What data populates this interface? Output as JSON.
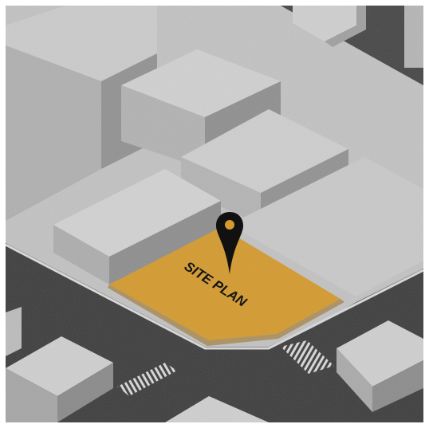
{
  "map": {
    "site_label": "SITE PLAN",
    "marker_icon": "location-pin-icon",
    "colors": {
      "road": "#3d3d3d",
      "sidewalk": "#cfcfcf",
      "lot": "#bdbdbd",
      "site": "#d49a2e",
      "building_top": "#c9c9c9",
      "building_left": "#a8a8a8",
      "building_right": "#8c8c8c",
      "pin": "#111111"
    }
  }
}
